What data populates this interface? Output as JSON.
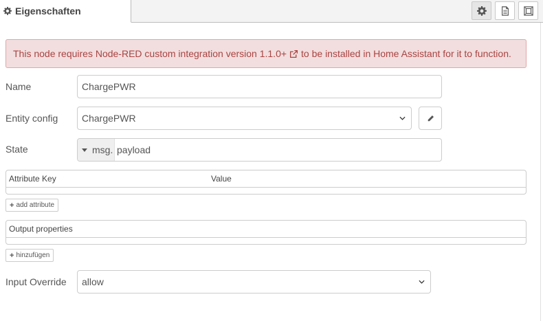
{
  "header": {
    "tab_label": "Eigenschaften",
    "buttons": [
      {
        "icon": "gear-icon",
        "active": true
      },
      {
        "icon": "document-icon",
        "active": false
      },
      {
        "icon": "frame-icon",
        "active": false
      }
    ]
  },
  "alert": {
    "text_before": "This node requires Node-RED custom integration version 1.1.0+",
    "text_after": "to be installed in Home Assistant for it to function.",
    "icon": "external-link-icon"
  },
  "form": {
    "name": {
      "label": "Name",
      "value": "ChargePWR"
    },
    "entity_config": {
      "label": "Entity config",
      "value": "ChargePWR",
      "edit_icon": "pencil-icon"
    },
    "state": {
      "label": "State",
      "type": "msg.",
      "value": "payload"
    },
    "attributes": {
      "col_key": "Attribute Key",
      "col_value": "Value",
      "add_label": "add attribute"
    },
    "output_properties": {
      "header": "Output properties",
      "add_label": "hinzufügen"
    },
    "input_override": {
      "label": "Input Override",
      "value": "allow"
    }
  },
  "colors": {
    "alert_bg": "#f2dede",
    "alert_text": "#a94442",
    "border": "#cccccc"
  }
}
